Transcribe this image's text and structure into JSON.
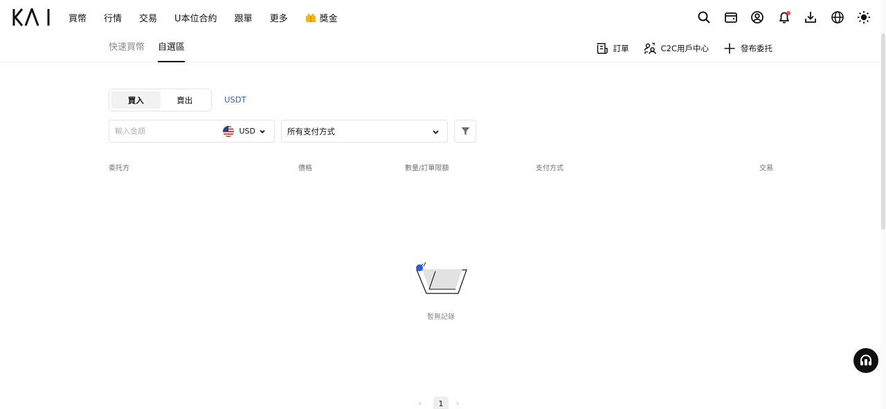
{
  "header": {
    "logo_text": "KAI",
    "nav": [
      "買幣",
      "行情",
      "交易",
      "U本位合約",
      "跟單",
      "更多"
    ],
    "rewards_label": "獎金",
    "icons": [
      "search-icon",
      "wallet-icon",
      "account-icon",
      "bell-icon",
      "download-icon",
      "globe-icon",
      "sun-icon"
    ]
  },
  "subnav": {
    "tabs": [
      "快速買幣",
      "自選區"
    ],
    "active_tab": "自選區",
    "links": {
      "orders": "訂單",
      "c2c_center": "C2C用戶中心",
      "post_ad": "發布委托"
    }
  },
  "trade": {
    "buy_label": "買入",
    "sell_label": "賣出",
    "active_side": "買入",
    "asset": "USDT"
  },
  "filters": {
    "amount_placeholder": "輸入金額",
    "currency": "USD",
    "payment_method": "所有支付方式"
  },
  "table": {
    "columns": [
      "委托方",
      "價格",
      "數量/訂單限額",
      "支付方式",
      "交易"
    ]
  },
  "empty_state": {
    "message": "暫無記錄"
  },
  "pagination": {
    "current_page": "1",
    "prev_icon": "‹",
    "next_icon": "›"
  },
  "colors": {
    "accent": "#2e5bdc",
    "text": "#111111",
    "muted": "#8a8a8a",
    "border": "#e3e3e3"
  }
}
